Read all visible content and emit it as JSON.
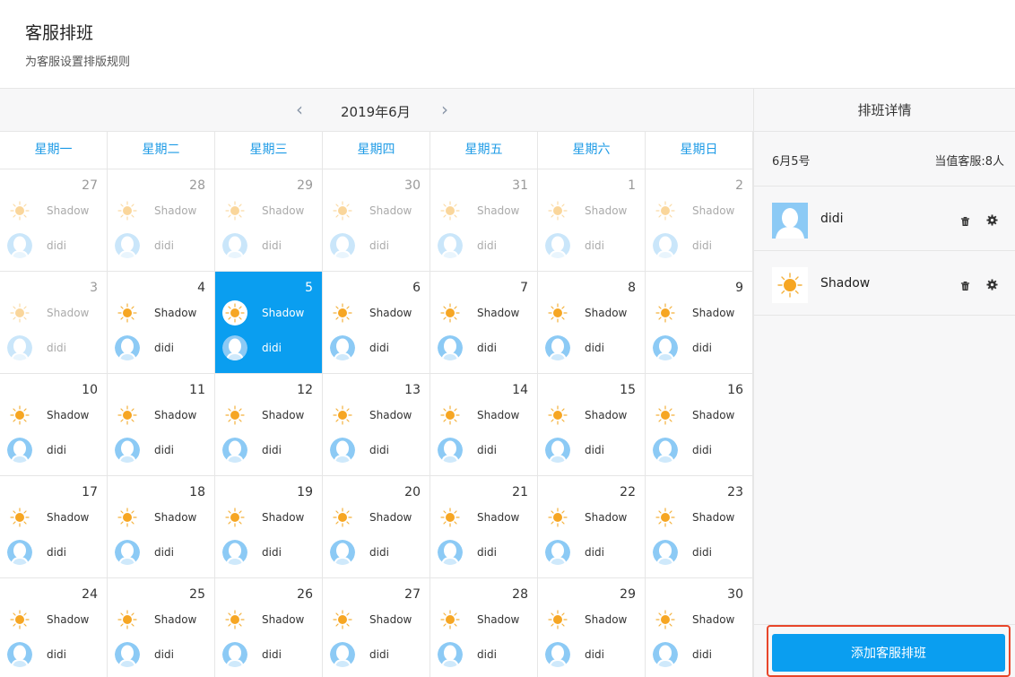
{
  "header": {
    "title": "客服排班",
    "subtitle": "为客服设置排版规则"
  },
  "calendar": {
    "month_label": "2019年6月",
    "prev_icon": "chevron-left-icon",
    "next_icon": "chevron-right-icon",
    "weekdays": [
      "星期一",
      "星期二",
      "星期三",
      "星期四",
      "星期五",
      "星期六",
      "星期日"
    ],
    "staff_labels": {
      "sun": "Shadow",
      "avatar": "didi"
    },
    "accent_color": "#0a9ef0",
    "weekday_color": "#1e9be6",
    "weeks": [
      [
        {
          "day": "27",
          "other": true
        },
        {
          "day": "28",
          "other": true
        },
        {
          "day": "29",
          "other": true
        },
        {
          "day": "30",
          "other": true
        },
        {
          "day": "31",
          "other": true
        },
        {
          "day": "1",
          "other": true
        },
        {
          "day": "2",
          "other": true
        }
      ],
      [
        {
          "day": "3",
          "other": true
        },
        {
          "day": "4"
        },
        {
          "day": "5",
          "selected": true
        },
        {
          "day": "6"
        },
        {
          "day": "7"
        },
        {
          "day": "8"
        },
        {
          "day": "9"
        }
      ],
      [
        {
          "day": "10"
        },
        {
          "day": "11"
        },
        {
          "day": "12"
        },
        {
          "day": "13"
        },
        {
          "day": "14"
        },
        {
          "day": "15"
        },
        {
          "day": "16"
        }
      ],
      [
        {
          "day": "17"
        },
        {
          "day": "18"
        },
        {
          "day": "19"
        },
        {
          "day": "20"
        },
        {
          "day": "21"
        },
        {
          "day": "22"
        },
        {
          "day": "23"
        }
      ],
      [
        {
          "day": "24"
        },
        {
          "day": "25"
        },
        {
          "day": "26"
        },
        {
          "day": "27"
        },
        {
          "day": "28"
        },
        {
          "day": "29"
        },
        {
          "day": "30"
        }
      ]
    ]
  },
  "detail": {
    "title": "排班详情",
    "date": "6月5号",
    "on_duty": "当值客服:8人",
    "items": [
      {
        "name": "didi",
        "icon": "avatar-icon"
      },
      {
        "name": "Shadow",
        "icon": "sun-icon"
      }
    ],
    "add_button": "添加客服排班",
    "highlight_color": "#e8462a"
  }
}
